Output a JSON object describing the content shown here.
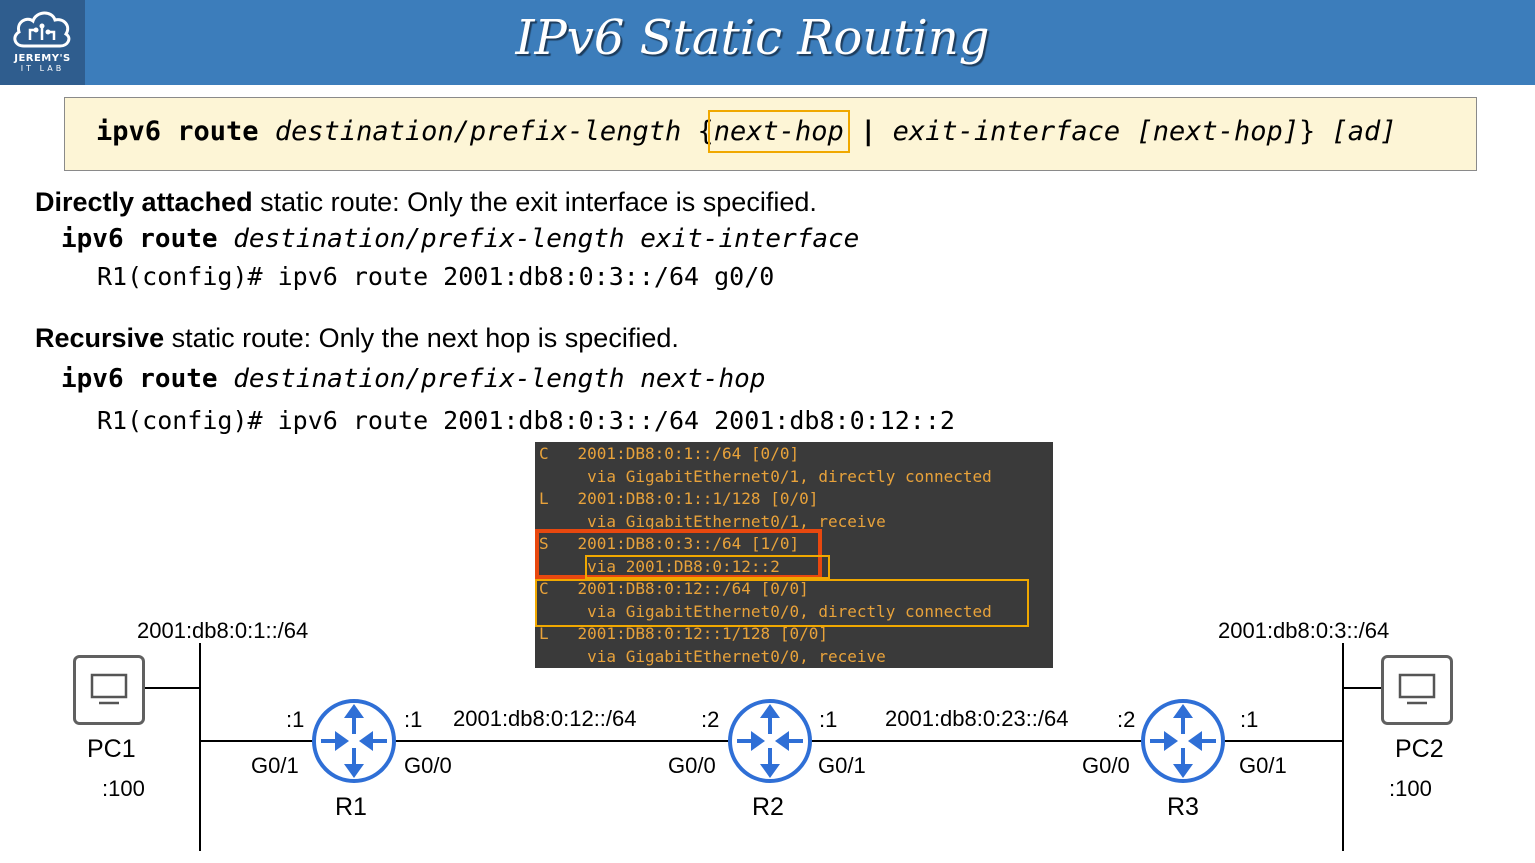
{
  "header": {
    "title": "IPv6 Static Routing",
    "logo_line1": "JEREMY'S",
    "logo_line2": "IT LAB"
  },
  "syntax": {
    "cmd": "ipv6 route",
    "dest": "destination/prefix-length",
    "brace_open": "{",
    "next_hop": "next-hop",
    "pipe": "|",
    "exit_iface": "exit-interface",
    "opt_next_hop": "[next-hop]",
    "brace_close": "}",
    "ad": "[ad]"
  },
  "directly": {
    "bold": "Directly attached",
    "rest": " static route: Only the exit interface is specified.",
    "syntax_cmd": "ipv6 route",
    "syntax_args": "destination/prefix-length exit-interface",
    "example": "R1(config)# ipv6 route 2001:db8:0:3::/64 g0/0"
  },
  "recursive": {
    "bold": "Recursive",
    "rest": " static route: Only the next hop is specified.",
    "syntax_cmd": "ipv6 route",
    "syntax_args": "destination/prefix-length next-hop",
    "example": "R1(config)# ipv6 route 2001:db8:0:3::/64 2001:db8:0:12::2"
  },
  "route_table": [
    "C   2001:DB8:0:1::/64 [0/0]",
    "     via GigabitEthernet0/1, directly connected",
    "L   2001:DB8:0:1::1/128 [0/0]",
    "     via GigabitEthernet0/1, receive",
    "S   2001:DB8:0:3::/64 [1/0]",
    "     via 2001:DB8:0:12::2",
    "C   2001:DB8:0:12::/64 [0/0]",
    "     via GigabitEthernet0/0, directly connected",
    "L   2001:DB8:0:12::1/128 [0/0]",
    "     via GigabitEthernet0/0, receive"
  ],
  "topology": {
    "net_left": "2001:db8:0:1::/64",
    "net_right": "2001:db8:0:3::/64",
    "net_12": "2001:db8:0:12::/64",
    "net_23": "2001:db8:0:23::/64",
    "pc1": {
      "name": "PC1",
      "addr": ":100"
    },
    "pc2": {
      "name": "PC2",
      "addr": ":100"
    },
    "r1": {
      "name": "R1",
      "left_host": ":1",
      "right_host": ":1",
      "left_if": "G0/1",
      "right_if": "G0/0"
    },
    "r2": {
      "name": "R2",
      "left_host": ":2",
      "right_host": ":1",
      "left_if": "G0/0",
      "right_if": "G0/1"
    },
    "r3": {
      "name": "R3",
      "left_host": ":2",
      "right_host": ":1",
      "left_if": "G0/0",
      "right_if": "G0/1"
    }
  },
  "colors": {
    "header_bg": "#3c7dbb",
    "router_blue": "#2f6fd6",
    "table_text": "#e8a23a",
    "highlight_yellow": "#f0a800",
    "highlight_red": "#e8480f"
  }
}
